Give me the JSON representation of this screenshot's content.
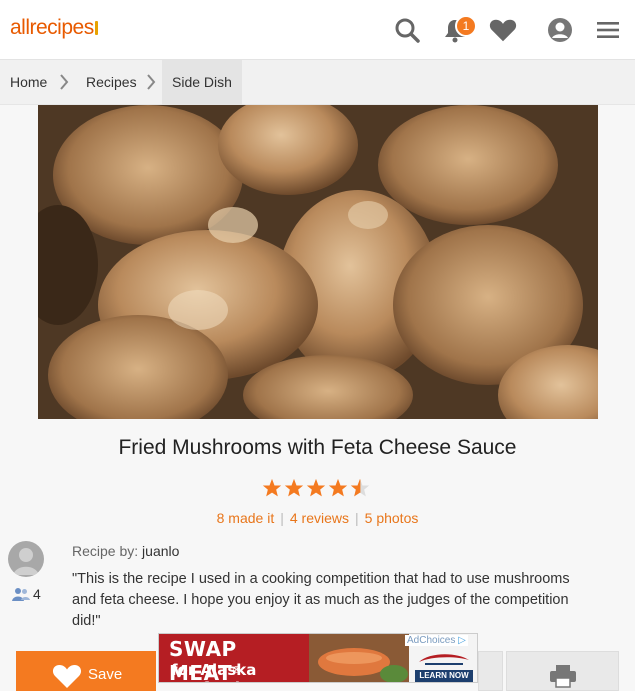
{
  "header": {
    "logo": "allrecipes",
    "notification_count": "1"
  },
  "breadcrumb": {
    "items": [
      "Home",
      "Recipes",
      "Side Dish"
    ]
  },
  "recipe": {
    "title": "Fried Mushrooms with Feta Cheese Sauce",
    "rating": 4.5,
    "made_it": "8 made it",
    "reviews": "4 reviews",
    "photos": "5 photos",
    "recipe_by_label": "Recipe by:",
    "author": "juanlo",
    "followers": "4",
    "description": "\"This is the recipe I used in a cooking competition that had to use mushrooms and feta cheese. I hope you enjoy it as much as the judges of the competition did!\""
  },
  "actions": {
    "save_label": "Save"
  },
  "ad": {
    "headline": "SWAP MEAT",
    "trademark": "®",
    "subline": "for Alaska Seafood",
    "adchoices": "AdChoices",
    "cta": "LEARN NOW"
  },
  "colors": {
    "accent": "#f47a20",
    "link": "#e8761b",
    "ad_red": "#b51e23"
  }
}
